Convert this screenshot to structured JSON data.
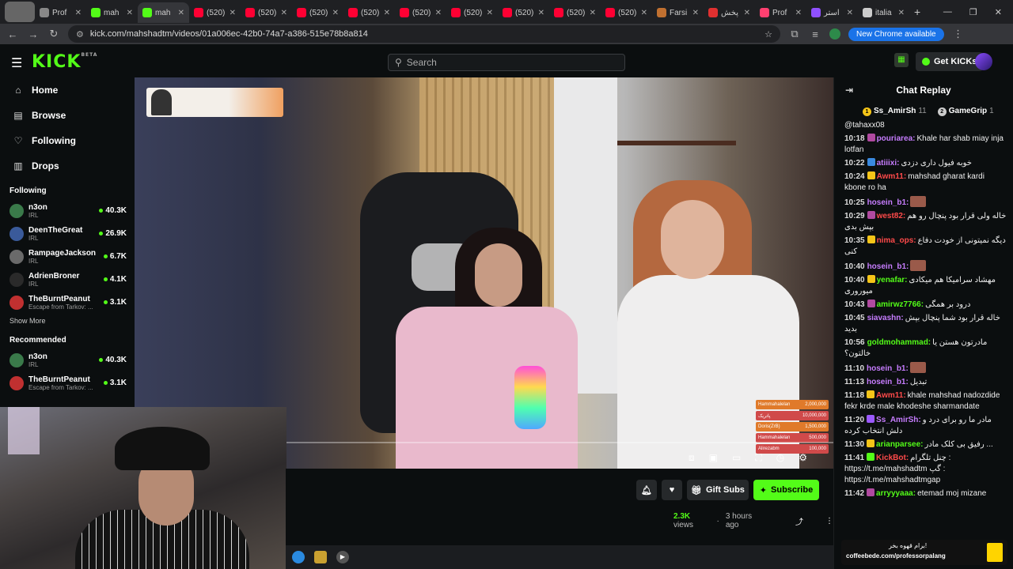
{
  "browser": {
    "tabs": [
      {
        "label": "Prof",
        "color": "#888888"
      },
      {
        "label": "mah",
        "color": "#53fc18"
      },
      {
        "label": "mah",
        "color": "#53fc18",
        "active": true
      },
      {
        "label": "(520)",
        "color": "#ff0033"
      },
      {
        "label": "(520)",
        "color": "#ff0033"
      },
      {
        "label": "(520)",
        "color": "#ff0033"
      },
      {
        "label": "(520)",
        "color": "#ff0033"
      },
      {
        "label": "(520)",
        "color": "#ff0033"
      },
      {
        "label": "(520)",
        "color": "#ff0033"
      },
      {
        "label": "(520)",
        "color": "#ff0033"
      },
      {
        "label": "(520)",
        "color": "#ff0033"
      },
      {
        "label": "(520)",
        "color": "#ff0033"
      },
      {
        "label": "Farsi",
        "color": "#c07030"
      },
      {
        "label": "پخش",
        "color": "#e03030"
      },
      {
        "label": "Prof",
        "color": "#ff4070"
      },
      {
        "label": "استر",
        "color": "#9050ff"
      },
      {
        "label": "italia",
        "color": "#cccccc"
      }
    ],
    "url": "kick.com/mahshadtm/videos/01a006ec-42b0-74a7-a386-515e78b8a814",
    "new_chrome": "New Chrome available"
  },
  "header": {
    "logo": "KICK",
    "logo_tag": "BETA",
    "search_placeholder": "Search",
    "get_kicks": "Get KICKs"
  },
  "sidebar": {
    "nav": [
      {
        "label": "Home",
        "icon": "⌂"
      },
      {
        "label": "Browse",
        "icon": "▤"
      },
      {
        "label": "Following",
        "icon": "♡"
      },
      {
        "label": "Drops",
        "icon": "▥"
      }
    ],
    "following_title": "Following",
    "following": [
      {
        "name": "n3on",
        "sub": "IRL",
        "viewers": "40.3K",
        "color": "#3a7a4a"
      },
      {
        "name": "DeenTheGreat",
        "sub": "IRL",
        "viewers": "26.9K",
        "color": "#3a5a9a"
      },
      {
        "name": "RampageJackson",
        "sub": "IRL",
        "viewers": "6.7K",
        "color": "#6a6a6a"
      },
      {
        "name": "AdrienBroner",
        "sub": "IRL",
        "viewers": "4.1K",
        "color": "#2a2a2a"
      },
      {
        "name": "TheBurntPeanut",
        "sub": "Escape from Tarkov: ...",
        "viewers": "3.1K",
        "color": "#c03030"
      }
    ],
    "show_more": "Show More",
    "recommended_title": "Recommended",
    "recommended": [
      {
        "name": "n3on",
        "sub": "IRL",
        "viewers": "40.3K",
        "color": "#3a7a4a"
      },
      {
        "name": "TheBurntPeanut",
        "sub": "Escape from Tarkov: ...",
        "viewers": "3.1K",
        "color": "#c03030"
      }
    ]
  },
  "video": {
    "gift_rows": [
      {
        "name": "Hammahalelan",
        "amount": "2,000,000",
        "color": "#e07a2a"
      },
      {
        "name": "پاتریک",
        "amount": "10,000,000",
        "color": "#d04a4a"
      },
      {
        "name": "Doris(ZrB)",
        "amount": "1,500,000",
        "color": "#e07a2a"
      },
      {
        "name": "Hammahalelan",
        "amount": "500,000",
        "color": "#d04a4a"
      },
      {
        "name": "Alirezabm",
        "amount": "100,000",
        "color": "#d04a4a"
      }
    ]
  },
  "below_video": {
    "gift_subs": "Gift Subs",
    "subscribe": "Subscribe",
    "views_count": "2.3K",
    "views_label": "views",
    "age": "3 hours ago"
  },
  "chat": {
    "title": "Chat Replay",
    "pinned": [
      {
        "name": "Ss_AmirSh",
        "count": "11"
      },
      {
        "name": "GameGrip",
        "count": "1"
      }
    ],
    "messages": [
      {
        "time": "",
        "user": "",
        "color": "#ffffff",
        "badge": "",
        "text": "@tahaxx08"
      },
      {
        "time": "10:18",
        "user": "pouriarea:",
        "color": "#c77dff",
        "badge": "#b04aa0",
        "text": "Khale har shab miay inja lotfan"
      },
      {
        "time": "10:22",
        "user": "atiiixi:",
        "color": "#c77dff",
        "badge": "#3a8ae0",
        "text": "خوبه فیول داری دزدی"
      },
      {
        "time": "10:24",
        "user": "Awm11:",
        "color": "#ff4a4a",
        "badge": "#f5c518",
        "text": "mahshad gharat kardi kbone ro ha"
      },
      {
        "time": "10:25",
        "user": "hosein_b1:",
        "color": "#c77dff",
        "badge": "",
        "text": ""
      },
      {
        "time": "10:29",
        "user": "west82:",
        "color": "#ff4a4a",
        "badge": "#b04aa0",
        "text": "خاله ولی قرار بود پنچال رو هم بپش بدی"
      },
      {
        "time": "10:35",
        "user": "nima_ops:",
        "color": "#ff4a4a",
        "badge": "#f5c518",
        "text": "دیگه نمیتونی از خودت دفاع کنی"
      },
      {
        "time": "10:40",
        "user": "hosein_b1:",
        "color": "#c77dff",
        "badge": "",
        "text": ""
      },
      {
        "time": "10:40",
        "user": "yenafar:",
        "color": "#53fc18",
        "badge": "#f5c518",
        "text": "مهشاد سرامیکا هم میکادی میوروری"
      },
      {
        "time": "10:43",
        "user": "amirwz7766:",
        "color": "#53fc18",
        "badge": "#b04aa0",
        "text": "درود بر همگی"
      },
      {
        "time": "10:45",
        "user": "siavashn:",
        "color": "#c77dff",
        "badge": "",
        "text": "خاله قرار بود شما پنچال بپش بدید"
      },
      {
        "time": "10:56",
        "user": "goldmohammad:",
        "color": "#53fc18",
        "badge": "",
        "text": "مادرتون هستن یا خالتون؟"
      },
      {
        "time": "11:10",
        "user": "hosein_b1:",
        "color": "#c77dff",
        "badge": "",
        "text": ""
      },
      {
        "time": "11:13",
        "user": "hosein_b1:",
        "color": "#c77dff",
        "badge": "",
        "text": "تبدیل"
      },
      {
        "time": "11:18",
        "user": "Awm11:",
        "color": "#ff4a4a",
        "badge": "#f5c518",
        "text": "khale mahshad nadozdide fekr krde male khodeshe sharmandate"
      },
      {
        "time": "11:20",
        "user": "Ss_AmirSh:",
        "color": "#c77dff",
        "badge": "#9b59ff",
        "text": "مادر ما رو برای درد و دلش انتخاب کرده"
      },
      {
        "time": "11:30",
        "user": "arianparsee:",
        "color": "#53fc18",
        "badge": "#f5c518",
        "text": "رفیق بی کلک مادر ..."
      },
      {
        "time": "11:41",
        "user": "KickBot:",
        "color": "#ff4a4a",
        "badge": "#53fc18",
        "text": "چنل تلگرام : https://t.me/mahshadtm گپ : https://t.me/mahshadtmgap"
      },
      {
        "time": "11:42",
        "user": "arryyyaaa:",
        "color": "#53fc18",
        "badge": "#b04aa0",
        "text": "etemad moj mizane"
      }
    ],
    "coffee_text": "coffeebede.com/professorpalang",
    "coffee_fa": "برام قهوه بخر!"
  }
}
